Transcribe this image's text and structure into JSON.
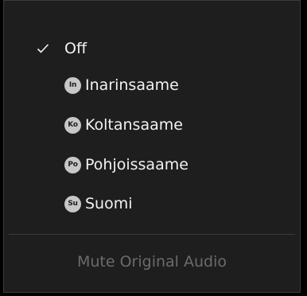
{
  "menu": {
    "off_label": "Off",
    "off_checked": true,
    "languages": [
      {
        "badge": "In",
        "label": "Inarinsaame"
      },
      {
        "badge": "Ko",
        "label": "Koltansaame"
      },
      {
        "badge": "Po",
        "label": "Pohjoissaame"
      },
      {
        "badge": "Su",
        "label": "Suomi"
      }
    ],
    "mute_label": "Mute Original Audio",
    "mute_enabled": false
  },
  "colors": {
    "background": "#1e1e1e",
    "text": "#f2f2f2",
    "disabled_text": "#6b6b6b",
    "badge": "#c7c7c7"
  }
}
